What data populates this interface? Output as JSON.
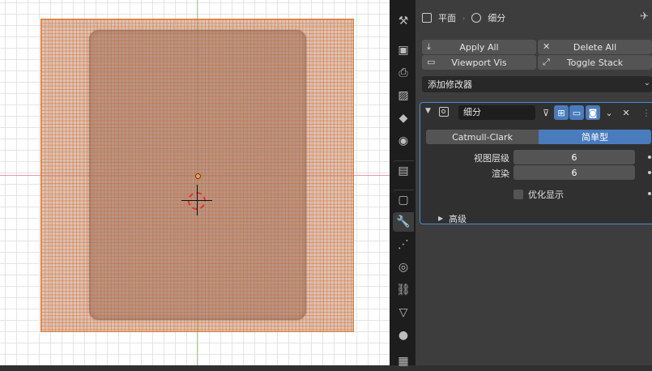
{
  "breadcrumb": {
    "object": "平面",
    "modifier": "细分"
  },
  "header_buttons": {
    "apply_all": "Apply All",
    "delete_all": "Delete All",
    "viewport_vis": "Viewport Vis",
    "toggle_stack": "Toggle Stack"
  },
  "add_modifier": "添加修改器",
  "modifier": {
    "name": "细分",
    "algorithms": [
      "Catmull-Clark",
      "简单型"
    ],
    "selected_algorithm": "简单型",
    "levels_viewport_label": "视图层级",
    "levels_viewport": "6",
    "render_label": "渲染",
    "render": "6",
    "optimal_display_label": "优化显示",
    "optimal_display": false,
    "advanced_label": "高级"
  },
  "tabs": [
    "tool-icon",
    "render-icon",
    "output-icon",
    "view-layer-icon",
    "scene-icon",
    "world-icon",
    "collection-icon",
    "object-icon",
    "modifier-icon",
    "particles-icon",
    "physics-icon",
    "constraints-icon",
    "data-icon",
    "material-icon",
    "texture-icon"
  ],
  "colors": {
    "accent": "#4a7bbd",
    "selection_outline": "#e07a2a",
    "panel_border": "#4a8ad8"
  }
}
